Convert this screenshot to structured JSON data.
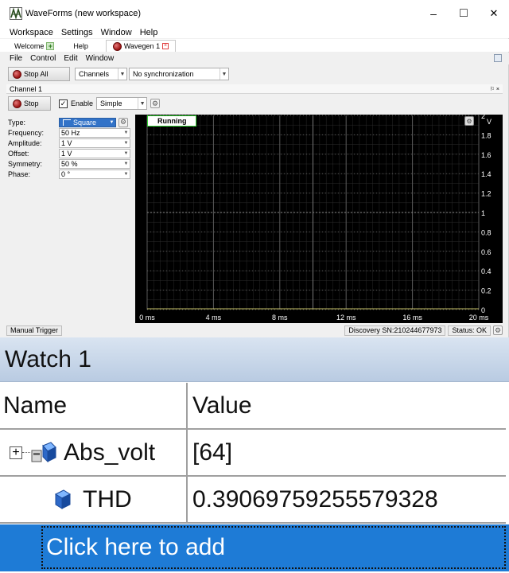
{
  "window": {
    "title": "WaveForms  (new workspace)",
    "minimize": "–",
    "maximize": "□",
    "close": "✕"
  },
  "menubar": [
    "Workspace",
    "Settings",
    "Window",
    "Help"
  ],
  "tabs": [
    {
      "label": "Welcome"
    },
    {
      "label": "Help"
    },
    {
      "label": "Wavegen 1"
    }
  ],
  "wavegen_menu": [
    "File",
    "Control",
    "Edit",
    "Window"
  ],
  "toolbar": {
    "stop_all": "Stop All",
    "channels": "Channels",
    "sync": "No synchronization"
  },
  "channel": {
    "title": "Channel 1",
    "pin_close": "⚐ ×",
    "stop": "Stop",
    "enable": "Enable",
    "mode": "Simple"
  },
  "params": [
    {
      "label": "Type:",
      "value": "Square"
    },
    {
      "label": "Frequency:",
      "value": "50 Hz"
    },
    {
      "label": "Amplitude:",
      "value": "1 V"
    },
    {
      "label": "Offset:",
      "value": "1 V"
    },
    {
      "label": "Symmetry:",
      "value": "50 %"
    },
    {
      "label": "Phase:",
      "value": "0 °"
    }
  ],
  "scope": {
    "status": "Running",
    "y_unit": "V",
    "y_ticks": [
      "2",
      "1.8",
      "1.6",
      "1.4",
      "1.2",
      "1",
      "0.8",
      "0.6",
      "0.4",
      "0.2",
      "0"
    ],
    "x_ticks": [
      "0 ms",
      "4 ms",
      "8 ms",
      "12 ms",
      "16 ms",
      "20 ms"
    ]
  },
  "statusbar": {
    "trigger": "Manual Trigger",
    "device": "Discovery SN:210244677973",
    "status": "Status: OK"
  },
  "watch": {
    "title": "Watch 1",
    "col_name": "Name",
    "col_value": "Value",
    "rows": [
      {
        "name": "Abs_volt",
        "value": "[64]"
      },
      {
        "name": "THD",
        "value": "0.39069759255579328"
      }
    ],
    "add_placeholder": "Click here to add"
  },
  "colors": {
    "accent": "#1e7bd6",
    "scope_bg": "#000000",
    "running_border": "#35d035"
  }
}
